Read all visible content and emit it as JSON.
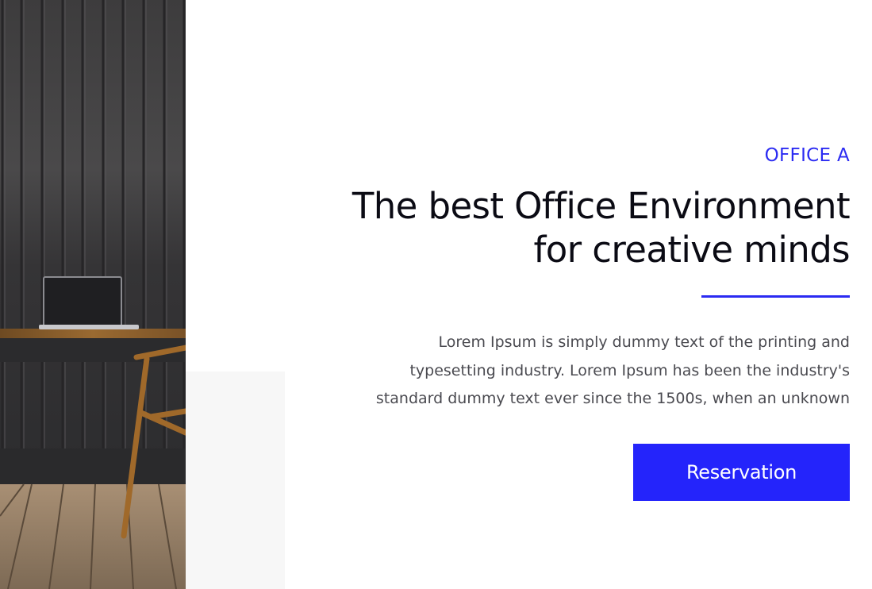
{
  "section": {
    "eyebrow": "OFFICE A",
    "headline_line1": "The best Office Environment",
    "headline_line2": "for creative minds",
    "body_line1": "Lorem Ipsum is simply dummy text of the printing and",
    "body_line2": "typesetting industry. Lorem Ipsum has been the industry's",
    "body_line3": "standard dummy text ever since the 1500s, when an unknown",
    "button_label": "Reservation"
  },
  "colors": {
    "accent": "#2424fb",
    "heading": "#0b0b14",
    "body": "#4a4a50",
    "panel": "#f7f7f7"
  }
}
